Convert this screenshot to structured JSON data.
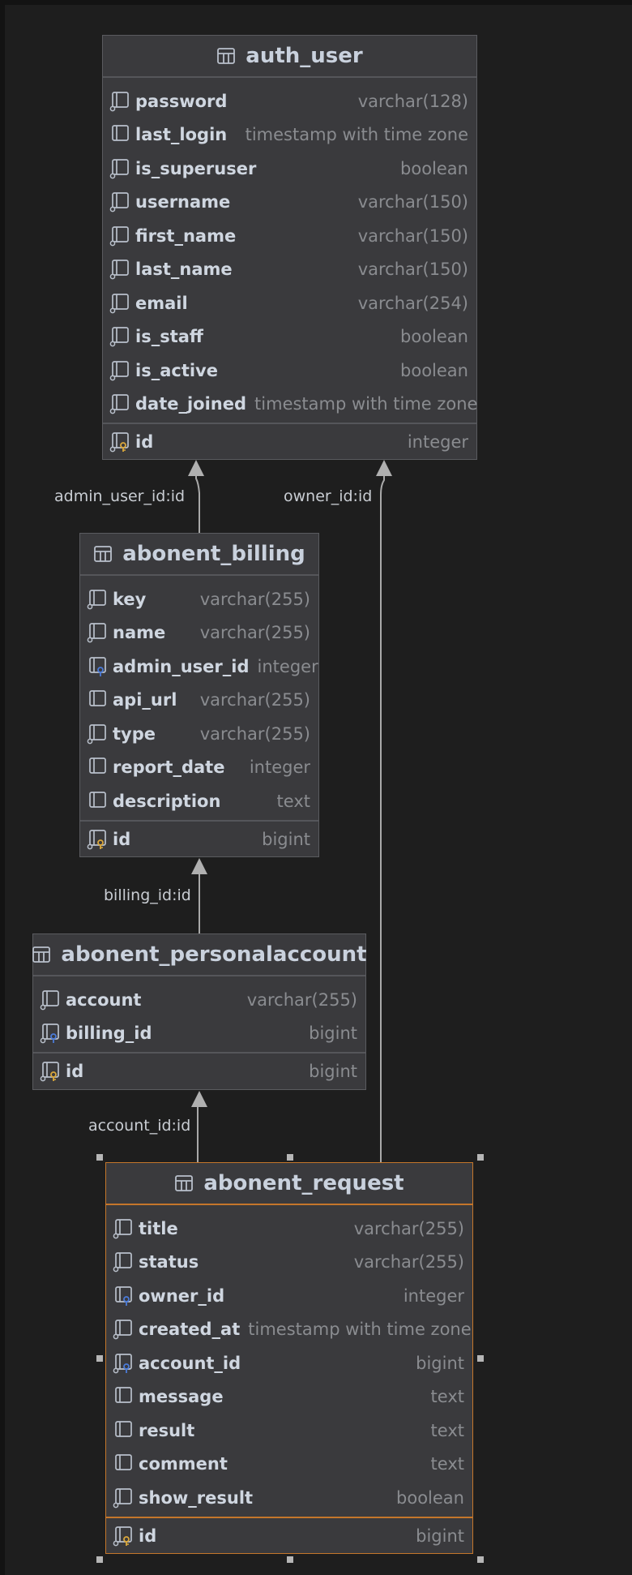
{
  "tables": {
    "auth_user": {
      "title": "auth_user",
      "columns": [
        {
          "name": "password",
          "type": "varchar(128)",
          "icon": "column-not-null"
        },
        {
          "name": "last_login",
          "type": "timestamp with time zone",
          "icon": "column-nullable"
        },
        {
          "name": "is_superuser",
          "type": "boolean",
          "icon": "column-not-null"
        },
        {
          "name": "username",
          "type": "varchar(150)",
          "icon": "column-not-null"
        },
        {
          "name": "first_name",
          "type": "varchar(150)",
          "icon": "column-not-null"
        },
        {
          "name": "last_name",
          "type": "varchar(150)",
          "icon": "column-not-null"
        },
        {
          "name": "email",
          "type": "varchar(254)",
          "icon": "column-not-null"
        },
        {
          "name": "is_staff",
          "type": "boolean",
          "icon": "column-not-null"
        },
        {
          "name": "is_active",
          "type": "boolean",
          "icon": "column-not-null"
        },
        {
          "name": "date_joined",
          "type": "timestamp with time zone",
          "icon": "column-not-null"
        }
      ],
      "pk": {
        "name": "id",
        "type": "integer",
        "icon": "primary-key"
      }
    },
    "abonent_billing": {
      "title": "abonent_billing",
      "columns": [
        {
          "name": "key",
          "type": "varchar(255)",
          "icon": "column-not-null"
        },
        {
          "name": "name",
          "type": "varchar(255)",
          "icon": "column-not-null"
        },
        {
          "name": "admin_user_id",
          "type": "integer",
          "icon": "foreign-key"
        },
        {
          "name": "api_url",
          "type": "varchar(255)",
          "icon": "column-nullable"
        },
        {
          "name": "type",
          "type": "varchar(255)",
          "icon": "column-not-null"
        },
        {
          "name": "report_date",
          "type": "integer",
          "icon": "column-nullable"
        },
        {
          "name": "description",
          "type": "text",
          "icon": "column-nullable"
        }
      ],
      "pk": {
        "name": "id",
        "type": "bigint",
        "icon": "primary-key"
      }
    },
    "abonent_personalaccount": {
      "title": "abonent_personalaccount",
      "columns": [
        {
          "name": "account",
          "type": "varchar(255)",
          "icon": "column-not-null"
        },
        {
          "name": "billing_id",
          "type": "bigint",
          "icon": "foreign-key-not-null"
        }
      ],
      "pk": {
        "name": "id",
        "type": "bigint",
        "icon": "primary-key"
      }
    },
    "abonent_request": {
      "title": "abonent_request",
      "columns": [
        {
          "name": "title",
          "type": "varchar(255)",
          "icon": "column-not-null"
        },
        {
          "name": "status",
          "type": "varchar(255)",
          "icon": "column-not-null"
        },
        {
          "name": "owner_id",
          "type": "integer",
          "icon": "foreign-key"
        },
        {
          "name": "created_at",
          "type": "timestamp with time zone",
          "icon": "column-not-null"
        },
        {
          "name": "account_id",
          "type": "bigint",
          "icon": "foreign-key-not-null"
        },
        {
          "name": "message",
          "type": "text",
          "icon": "column-nullable"
        },
        {
          "name": "result",
          "type": "text",
          "icon": "column-nullable"
        },
        {
          "name": "comment",
          "type": "text",
          "icon": "column-nullable"
        },
        {
          "name": "show_result",
          "type": "boolean",
          "icon": "column-not-null"
        }
      ],
      "pk": {
        "name": "id",
        "type": "bigint",
        "icon": "primary-key"
      }
    }
  },
  "relations": [
    {
      "label": "admin_user_id:id"
    },
    {
      "label": "owner_id:id"
    },
    {
      "label": "billing_id:id"
    },
    {
      "label": "account_id:id"
    }
  ],
  "colors": {
    "background": "#1e1e1e",
    "table_fill": "#3a3a3d",
    "table_border": "#5a5b5f",
    "selected_border": "#c4762b",
    "pk_key": "#d9a73c",
    "fk_key": "#4b7bd8",
    "edge": "#a9a9a9"
  }
}
